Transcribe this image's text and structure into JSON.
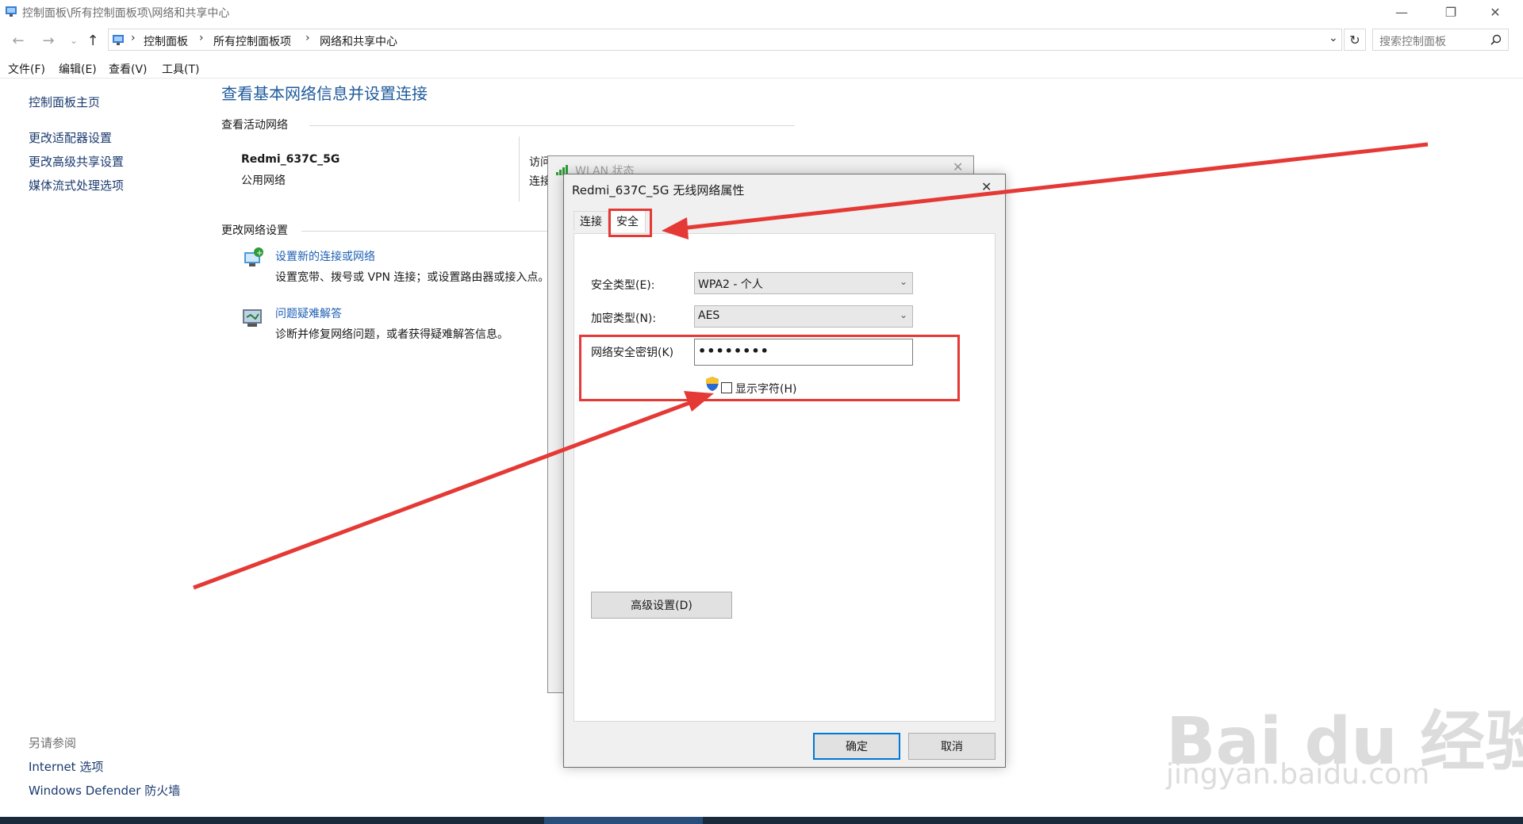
{
  "window": {
    "title": "控制面板\\所有控制面板项\\网络和共享中心",
    "minimize": "—",
    "restore": "❐",
    "close": "✕"
  },
  "address": {
    "crumbs": [
      "控制面板",
      "所有控制面板项",
      "网络和共享中心"
    ],
    "separator": "›",
    "search_placeholder": "搜索控制面板"
  },
  "menu": [
    "文件(F)",
    "编辑(E)",
    "查看(V)",
    "工具(T)"
  ],
  "sidebar": {
    "items": [
      "控制面板主页",
      "更改适配器设置",
      "更改高级共享设置",
      "媒体流式处理选项"
    ],
    "see_also_title": "另请参阅",
    "see_also": [
      "Internet 选项",
      "Windows Defender 防火墙"
    ]
  },
  "main": {
    "title": "查看基本网络信息并设置连接",
    "active_networks": "查看活动网络",
    "network_name": "Redmi_637C_5G",
    "network_type": "公用网络",
    "access_type_label": "访问类型:",
    "connection_label": "连接:",
    "change_settings": "更改网络设置",
    "setup_link": "设置新的连接或网络",
    "setup_desc": "设置宽带、拨号或 VPN 连接；或设置路由器或接入点。",
    "troubleshoot_link": "问题疑难解答",
    "troubleshoot_desc": "诊断并修复网络问题，或者获得疑难解答信息。"
  },
  "wlan_dialog": {
    "title": "WLAN 状态"
  },
  "dialog": {
    "title": "Redmi_637C_5G 无线网络属性",
    "tabs": [
      "连接",
      "安全"
    ],
    "security_type_label": "安全类型(E):",
    "security_type_value": "WPA2 - 个人",
    "encryption_type_label": "加密类型(N):",
    "encryption_type_value": "AES",
    "key_label": "网络安全密钥(K)",
    "key_value": "••••••••",
    "show_chars": "显示字符(H)",
    "advanced": "高级设置(D)",
    "ok": "确定",
    "cancel": "取消"
  },
  "watermark": {
    "brand": "Bai du 经验",
    "url": "jingyan.baidu.com"
  },
  "colors": {
    "annotation": "#e53935",
    "link": "#1e5fb4",
    "heading": "#1e5a9c"
  }
}
